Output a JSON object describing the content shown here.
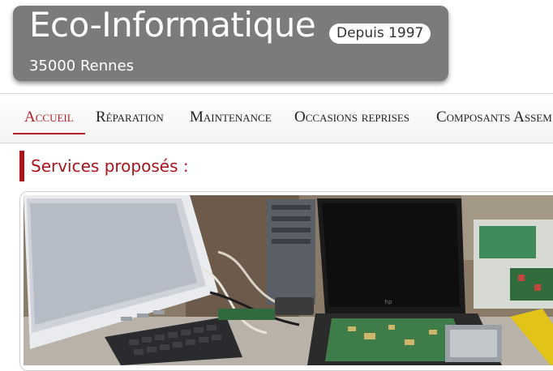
{
  "header": {
    "title": "Eco-Informatique",
    "since_badge": "Depuis 1997",
    "city": "35000 Rennes"
  },
  "nav": {
    "items": [
      {
        "label": "Accueil",
        "active": true
      },
      {
        "label": "Réparation",
        "active": false
      },
      {
        "label": "Maintenance",
        "active": false
      },
      {
        "label": "Occasions reprises",
        "active": false
      },
      {
        "label": "Composants Assem",
        "active": false
      }
    ]
  },
  "main": {
    "section_title": "Services proposés :"
  },
  "colors": {
    "header_bg": "#7b7b7b",
    "accent": "#a8141b"
  }
}
